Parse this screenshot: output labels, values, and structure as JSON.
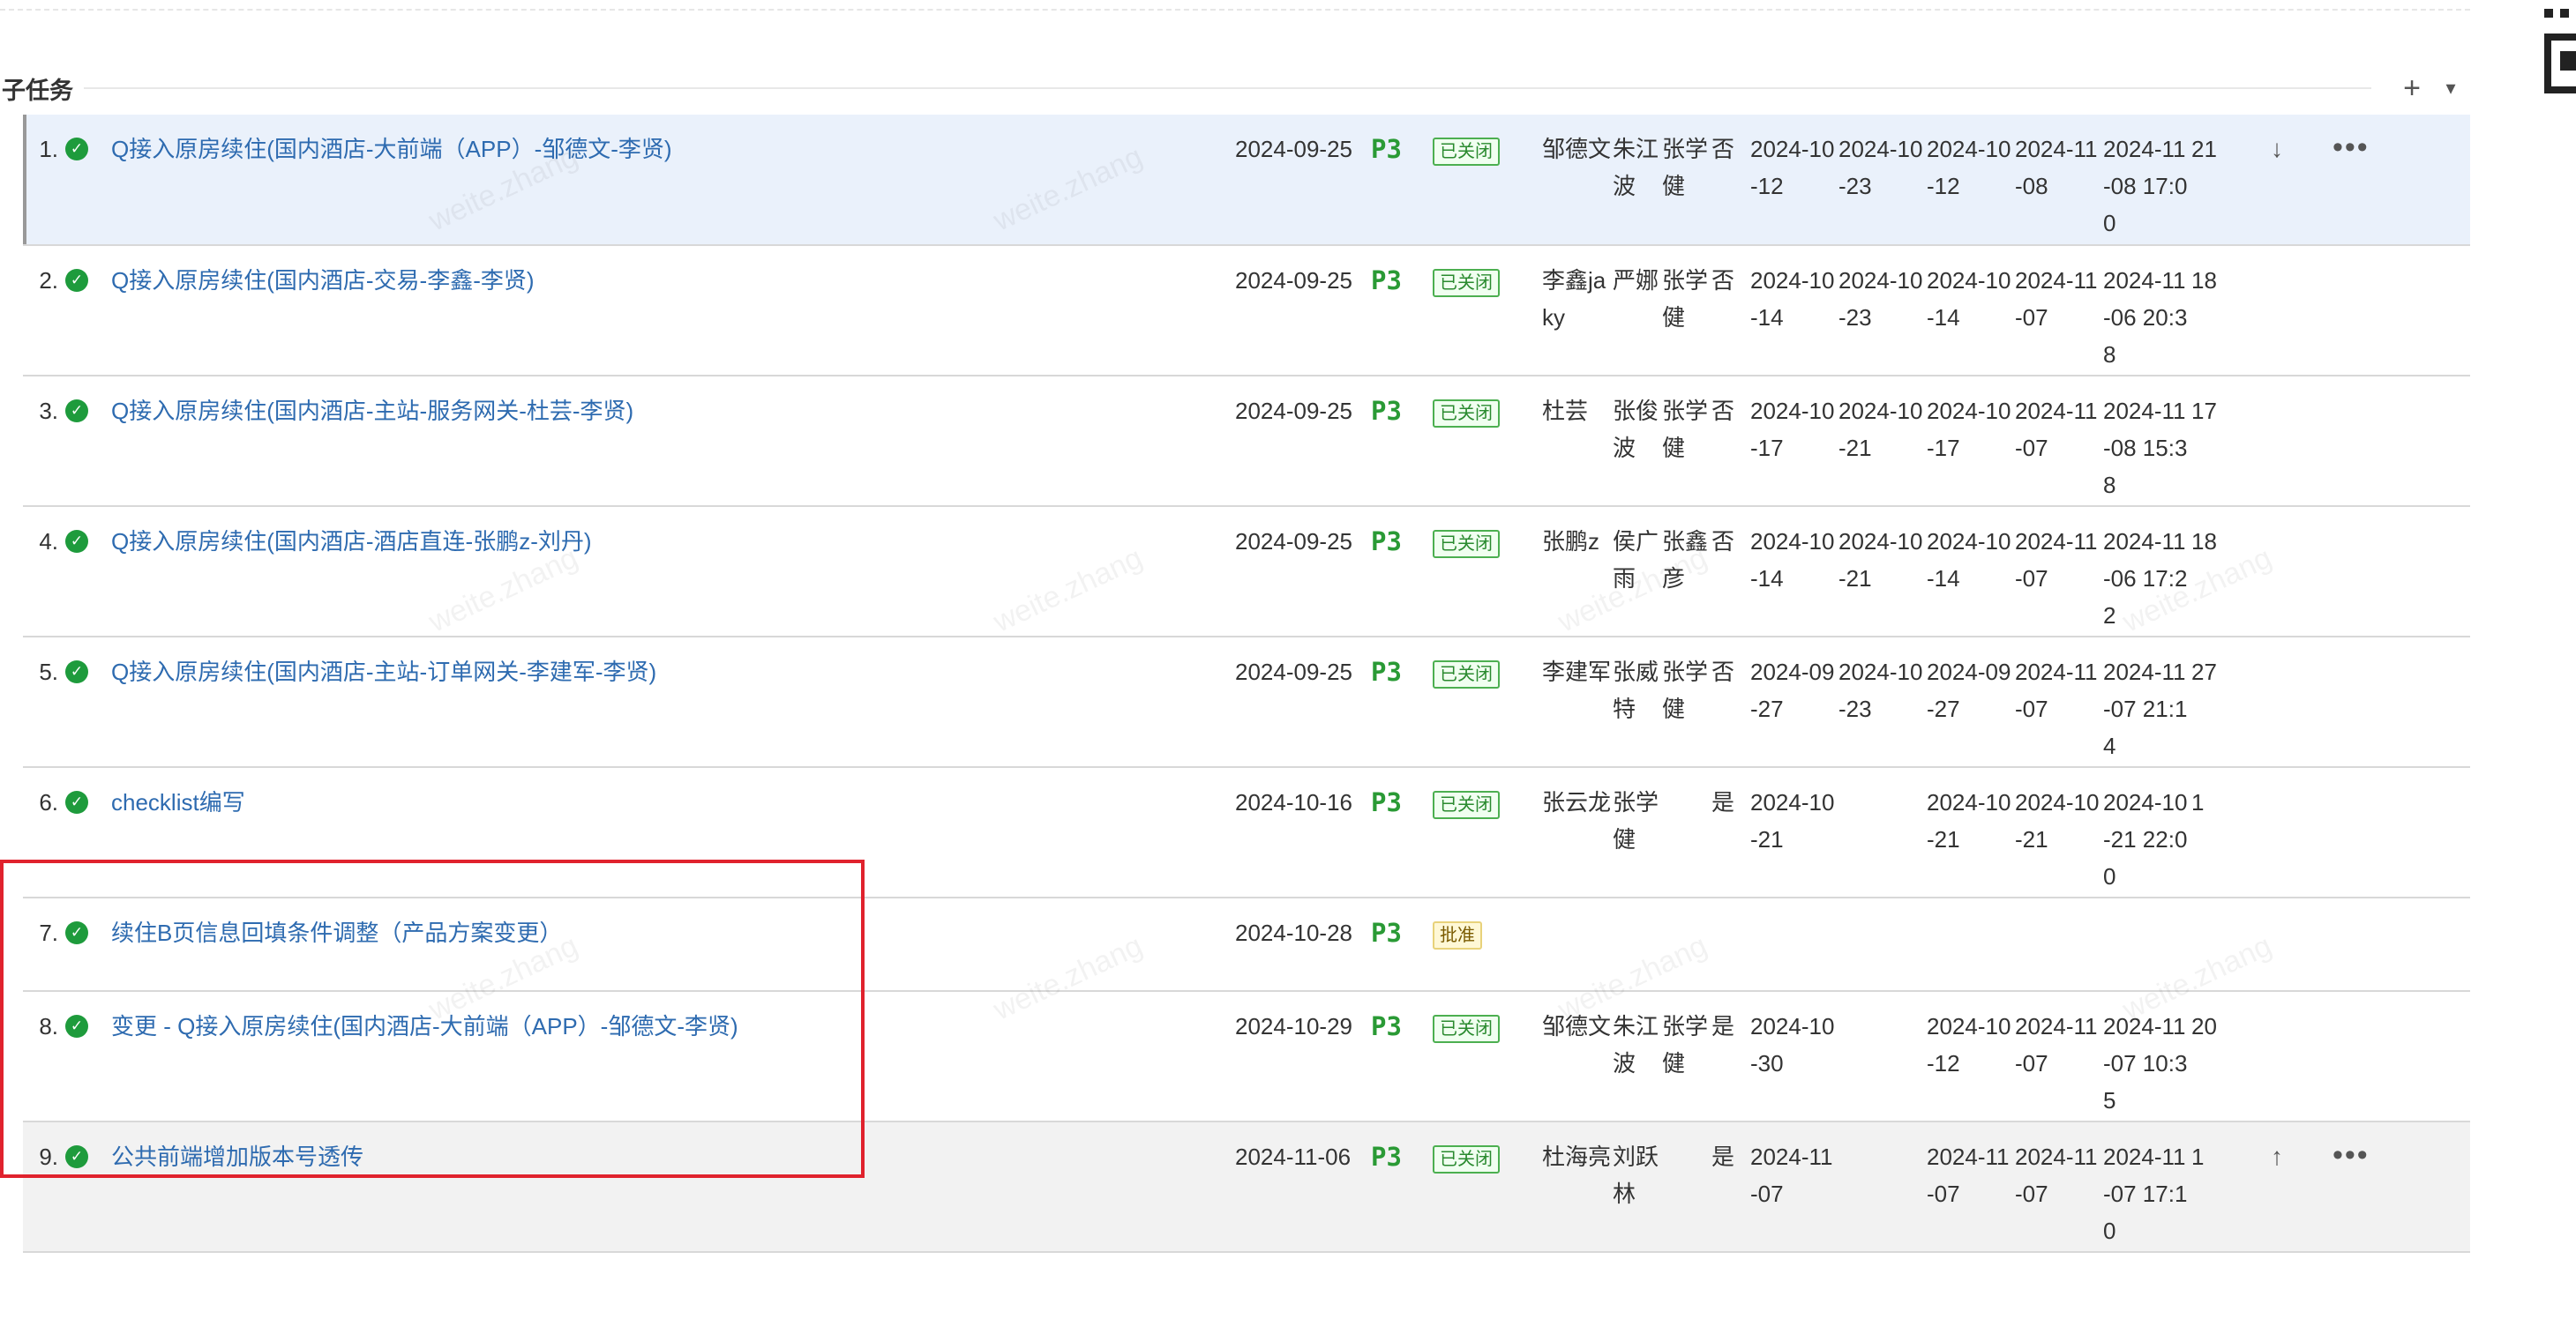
{
  "section": {
    "title": "子任务"
  },
  "header": {
    "add_icon": "plus-icon",
    "menu_icon": "chevron-down-icon"
  },
  "watermark": "weite.zhang",
  "rows": [
    {
      "index": "1.",
      "title": "Q接入原房续住(国内酒店-大前端（APP）-邹德文-李贤)",
      "date": "2024-09-25",
      "priority": "P3",
      "status": "已关闭",
      "owner": "邹德文",
      "col2": "朱江波",
      "col3": "张学健",
      "flag": "否",
      "d1": "2024-10-12",
      "d2": "2024-10-23",
      "d3": "2024-10-12",
      "d4": "2024-11-08",
      "d5": "2024-11-08 17:00",
      "count": "21",
      "move": "↓",
      "more": "•••"
    },
    {
      "index": "2.",
      "title": "Q接入原房续住(国内酒店-交易-李鑫-李贤)",
      "date": "2024-09-25",
      "priority": "P3",
      "status": "已关闭",
      "owner": "李鑫jaky",
      "col2": "严娜",
      "col3": "张学健",
      "flag": "否",
      "d1": "2024-10-14",
      "d2": "2024-10-23",
      "d3": "2024-10-14",
      "d4": "2024-11-07",
      "d5": "2024-11-06 20:38",
      "count": "18",
      "move": "",
      "more": ""
    },
    {
      "index": "3.",
      "title": "Q接入原房续住(国内酒店-主站-服务网关-杜芸-李贤)",
      "date": "2024-09-25",
      "priority": "P3",
      "status": "已关闭",
      "owner": "杜芸",
      "col2": "张俊波",
      "col3": "张学健",
      "flag": "否",
      "d1": "2024-10-17",
      "d2": "2024-10-21",
      "d3": "2024-10-17",
      "d4": "2024-11-07",
      "d5": "2024-11-08 15:38",
      "count": "17",
      "move": "",
      "more": ""
    },
    {
      "index": "4.",
      "title": "Q接入原房续住(国内酒店-酒店直连-张鹏z-刘丹)",
      "date": "2024-09-25",
      "priority": "P3",
      "status": "已关闭",
      "owner": "张鹏z",
      "col2": "侯广雨",
      "col3": "张鑫彦",
      "flag": "否",
      "d1": "2024-10-14",
      "d2": "2024-10-21",
      "d3": "2024-10-14",
      "d4": "2024-11-07",
      "d5": "2024-11-06 17:22",
      "count": "18",
      "move": "",
      "more": ""
    },
    {
      "index": "5.",
      "title": "Q接入原房续住(国内酒店-主站-订单网关-李建军-李贤)",
      "date": "2024-09-25",
      "priority": "P3",
      "status": "已关闭",
      "owner": "李建军",
      "col2": "张威特",
      "col3": "张学健",
      "flag": "否",
      "d1": "2024-09-27",
      "d2": "2024-10-23",
      "d3": "2024-09-27",
      "d4": "2024-11-07",
      "d5": "2024-11-07 21:14",
      "count": "27",
      "move": "",
      "more": ""
    },
    {
      "index": "6.",
      "title": "checklist编写",
      "date": "2024-10-16",
      "priority": "P3",
      "status": "已关闭",
      "owner": "张云龙",
      "col2": "张学健",
      "col3": "",
      "flag": "是",
      "d1": "2024-10-21",
      "d2": "",
      "d3": "2024-10-21",
      "d4": "2024-10-21",
      "d5": "2024-10-21 22:00",
      "count": "1",
      "move": "",
      "more": ""
    },
    {
      "index": "7.",
      "title": "续住B页信息回填条件调整（产品方案变更）",
      "date": "2024-10-28",
      "priority": "P3",
      "status": "批准",
      "owner": "",
      "col2": "",
      "col3": "",
      "flag": "",
      "d1": "",
      "d2": "",
      "d3": "",
      "d4": "",
      "d5": "",
      "count": "",
      "move": "",
      "more": ""
    },
    {
      "index": "8.",
      "title": "变更 - Q接入原房续住(国内酒店-大前端（APP）-邹德文-李贤)",
      "date": "2024-10-29",
      "priority": "P3",
      "status": "已关闭",
      "owner": "邹德文",
      "col2": "朱江波",
      "col3": "张学健",
      "flag": "是",
      "d1": "2024-10-30",
      "d2": "",
      "d3": "2024-10-12",
      "d4": "2024-11-07",
      "d5": "2024-11-07 10:35",
      "count": "20",
      "move": "",
      "more": ""
    },
    {
      "index": "9.",
      "title": "公共前端增加版本号透传",
      "date": "2024-11-06",
      "priority": "P3",
      "status": "已关闭",
      "owner": "杜海亮",
      "col2": "刘跃林",
      "col3": "",
      "flag": "是",
      "d1": "2024-11-07",
      "d2": "",
      "d3": "2024-11-07",
      "d4": "2024-11-07",
      "d5": "2024-11-07 17:10",
      "count": "1",
      "move": "↑",
      "more": "•••"
    }
  ]
}
